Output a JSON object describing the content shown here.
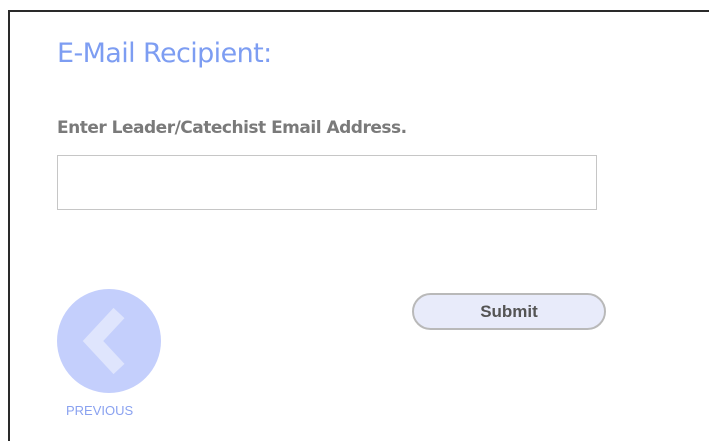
{
  "form": {
    "title": "E-Mail Recipient:",
    "email_label": "Enter Leader/Catechist Email Address.",
    "email_value": "",
    "email_placeholder": "",
    "submit_label": "Submit"
  },
  "navigation": {
    "previous_label": "PREVIOUS",
    "previous_icon": "chevron-left-icon"
  },
  "colors": {
    "title": "#7d9df2",
    "label": "#7a7a7a",
    "previous_circle": "#c4cffc",
    "previous_text": "#8aa2f0",
    "submit_background": "#e8ebfa"
  }
}
